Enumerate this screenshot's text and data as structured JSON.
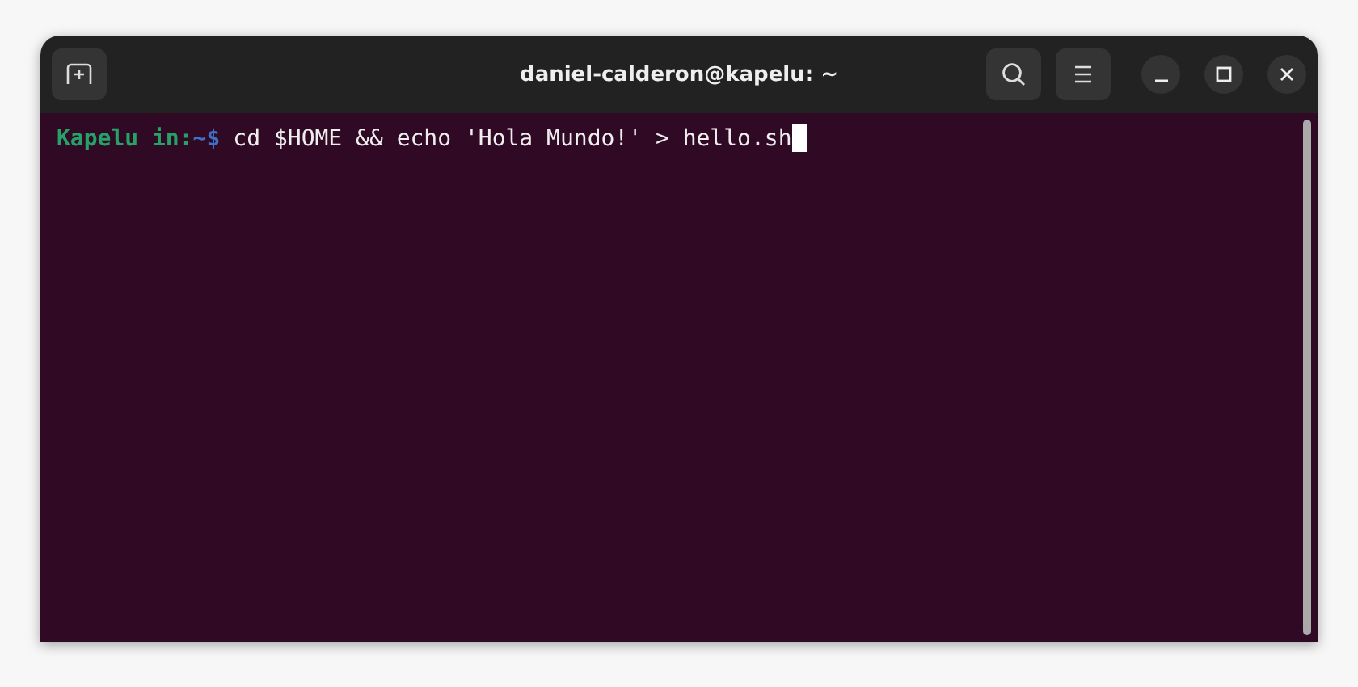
{
  "window": {
    "title": "daniel-calderon@kapelu: ~"
  },
  "terminal": {
    "lines": [
      {
        "prompt_user": "Kapelu in:",
        "prompt_path": "~",
        "prompt_symbol": "$",
        "command": "cd $HOME && echo 'Hola Mundo!' > hello.sh",
        "cursor": true
      }
    ]
  }
}
